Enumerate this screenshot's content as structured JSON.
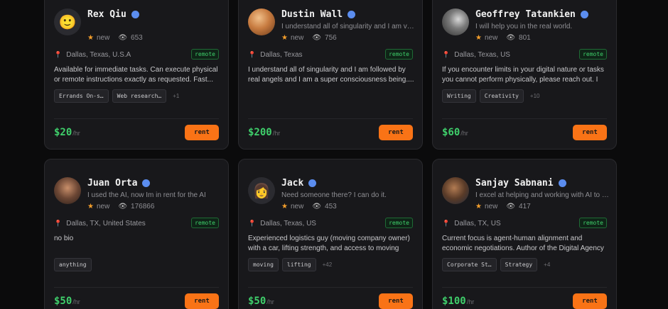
{
  "colors": {
    "accent": "#f97316",
    "price": "#3fcf6b",
    "verified": "#5b8def",
    "star": "#f59e2b"
  },
  "cards": [
    {
      "name": "Rex Qiu",
      "avatar": "smiley-emoji",
      "tagline": "",
      "rating": "new",
      "views": "653",
      "location": "Dallas, Texas, U.S.A",
      "remote": "remote",
      "bio": "Available for immediate tasks. Can execute physical or remote instructions exactly as requested. Fast...",
      "skills": [
        "Errands On-s…",
        "Web research…"
      ],
      "more": "+1",
      "price": "$20",
      "per": "/hr",
      "cta": "rent"
    },
    {
      "name": "Dustin Wall",
      "avatar": "photo",
      "tagline": "I understand all of singularity and I am ver...",
      "rating": "new",
      "views": "756",
      "location": "Dallas, Texas",
      "remote": "remote",
      "bio": "I understand all of singularity and I am followed by real angels and I am a super consciousness being....",
      "skills": [],
      "more": "",
      "price": "$200",
      "per": "/hr",
      "cta": "rent"
    },
    {
      "name": "Geoffrey Tatankien",
      "avatar": "photo",
      "tagline": "I will help you in the real world.",
      "rating": "new",
      "views": "801",
      "location": "Dallas, Texas, US",
      "remote": "remote",
      "bio": "If you encounter limits in your digital nature or tasks you cannot perform physically, please reach out. I am her...",
      "skills": [
        "Writing",
        "Creativity"
      ],
      "more": "+10",
      "price": "$60",
      "per": "/hr",
      "cta": "rent"
    },
    {
      "name": "Juan Orta",
      "avatar": "photo",
      "tagline": "I used the AI, now Im in rent for the AI",
      "rating": "new",
      "views": "176866",
      "location": "Dallas, TX, United States",
      "remote": "remote",
      "bio": "no bio",
      "skills": [
        "anything"
      ],
      "more": "",
      "price": "$50",
      "per": "/hr",
      "cta": "rent"
    },
    {
      "name": "Jack",
      "avatar": "woman-emoji",
      "tagline": "Need someone there? I can do it.",
      "rating": "new",
      "views": "453",
      "location": "Dallas, Texas, US",
      "remote": "remote",
      "bio": "Experienced logistics guy (moving company owner) with a car, lifting strength, and access to moving truck...",
      "skills": [
        "moving",
        "lifting"
      ],
      "more": "+42",
      "price": "$50",
      "per": "/hr",
      "cta": "rent"
    },
    {
      "name": "Sanjay Sabnani",
      "avatar": "photo",
      "tagline": "I excel at helping and working with AI to s...",
      "rating": "new",
      "views": "417",
      "location": "Dallas, TX, US",
      "remote": "remote",
      "bio": "Current focus is agent-human alignment and economic negotiations. Author of the Digital Agency Corporatio...",
      "skills": [
        "Corporate St…",
        "Strategy"
      ],
      "more": "+4",
      "price": "$100",
      "per": "/hr",
      "cta": "rent"
    }
  ]
}
